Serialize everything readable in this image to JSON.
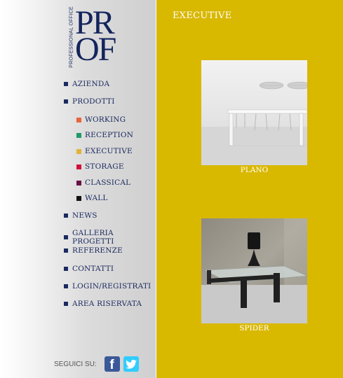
{
  "brand": {
    "vertical_text": "PROFESSIONAL OFFICE",
    "logo_line1": "PR",
    "logo_line2": "OF"
  },
  "nav": {
    "items": [
      {
        "label": "AZIENDA"
      },
      {
        "label": "PRODOTTI"
      },
      {
        "label": "NEWS"
      },
      {
        "label": "GALLERIA PROGETTI"
      },
      {
        "label": "REFERENZE"
      },
      {
        "label": "CONTATTI"
      },
      {
        "label": "LOGIN/REGISTRATI"
      },
      {
        "label": "AREA RISERVATA"
      }
    ],
    "subitems": [
      {
        "label": "WORKING",
        "color": "#e8643c"
      },
      {
        "label": "RECEPTION",
        "color": "#1e9a6a"
      },
      {
        "label": "EXECUTIVE",
        "color": "#e0b43a"
      },
      {
        "label": "STORAGE",
        "color": "#d0103a"
      },
      {
        "label": "CLASSICAL",
        "color": "#6a1046"
      },
      {
        "label": "WALL",
        "color": "#111111"
      }
    ]
  },
  "social": {
    "label": "SEGUICI SU:",
    "facebook_icon": "facebook-icon",
    "twitter_icon": "twitter-icon"
  },
  "main": {
    "title": "EXECUTIVE",
    "background": "#d9b800",
    "products": [
      {
        "name": "PLANO"
      },
      {
        "name": "SPIDER"
      }
    ]
  }
}
